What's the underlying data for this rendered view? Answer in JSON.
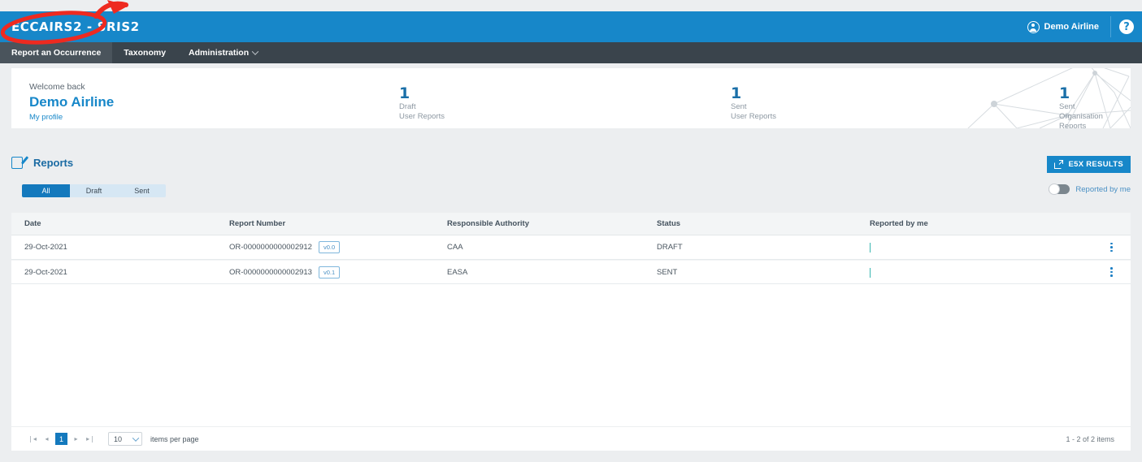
{
  "topbar": {
    "logo": "ECCAIRS2 - SRIS2",
    "user_name": "Demo Airline",
    "user_icon": "user-circle-icon",
    "help_label": "?",
    "accent_color": "#1787c9"
  },
  "nav": {
    "items": [
      {
        "label": "Report an Occurrence",
        "active": true,
        "has_caret": false
      },
      {
        "label": "Taxonomy",
        "active": false,
        "has_caret": false
      },
      {
        "label": "Administration",
        "active": false,
        "has_caret": true
      }
    ]
  },
  "welcome": {
    "greeting": "Welcome back",
    "name": "Demo Airline",
    "profile_link": "My profile",
    "stats": [
      {
        "value": "1",
        "line1": "Draft",
        "line2": "User Reports"
      },
      {
        "value": "1",
        "line1": "Sent",
        "line2": "User Reports"
      },
      {
        "value": "1",
        "line1": "Sent",
        "line2": "Organisation Reports"
      }
    ]
  },
  "reports": {
    "title": "Reports",
    "title_icon": "edit-square-icon",
    "e5x_button": "E5X RESULTS",
    "e5x_icon": "external-link-icon",
    "filter_tabs": [
      {
        "label": "All",
        "active": true
      },
      {
        "label": "Draft",
        "active": false
      },
      {
        "label": "Sent",
        "active": false
      }
    ],
    "toggle": {
      "label": "Reported by me",
      "state": "off"
    }
  },
  "table": {
    "headers": [
      "Date",
      "Report Number",
      "Responsible Authority",
      "Status",
      "Reported by me"
    ],
    "rows": [
      {
        "date": "29-Oct-2021",
        "report_number": "OR-0000000000002912",
        "version": "v0.0",
        "authority": "CAA",
        "status": "DRAFT",
        "reported_by_me": true
      },
      {
        "date": "29-Oct-2021",
        "report_number": "OR-0000000000002913",
        "version": "v0.1",
        "authority": "EASA",
        "status": "SENT",
        "reported_by_me": true
      }
    ]
  },
  "footer": {
    "first_icon": "❘◂",
    "prev_icon": "◂",
    "page": "1",
    "next_icon": "▸",
    "last_icon": "▸❘",
    "page_size": "10",
    "items_per_page_label": "items per page",
    "items_count": "1 - 2 of 2 items"
  },
  "annotation": {
    "type": "red-ellipse-with-arrow",
    "color": "#ee2a20",
    "target": "ECCAIRS2 - SRIS2 logo"
  }
}
